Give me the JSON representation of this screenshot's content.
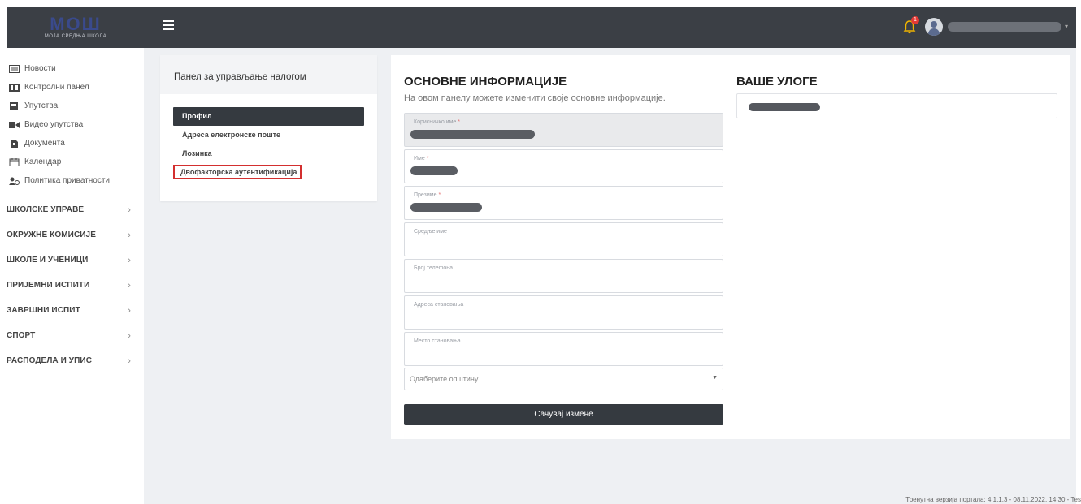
{
  "header": {
    "logo_text": "МОШ",
    "logo_subtitle": "МОЈА СРЕДЊА ШКОЛА",
    "notification_count": "1"
  },
  "sidebar": {
    "items": [
      {
        "label": "Новости",
        "icon": "newspaper-icon"
      },
      {
        "label": "Контролни панел",
        "icon": "dashboard-icon"
      },
      {
        "label": "Упутства",
        "icon": "book-icon"
      },
      {
        "label": "Видео упутства",
        "icon": "video-icon"
      },
      {
        "label": "Документа",
        "icon": "document-icon"
      },
      {
        "label": "Календар",
        "icon": "calendar-icon"
      },
      {
        "label": "Политика приватности",
        "icon": "users-privacy-icon"
      }
    ],
    "sections": [
      {
        "label": "ШКОЛСКЕ УПРАВЕ"
      },
      {
        "label": "ОКРУЖНЕ КОМИСИЈЕ"
      },
      {
        "label": "ШКОЛЕ И УЧЕНИЦИ"
      },
      {
        "label": "ПРИЈЕМНИ ИСПИТИ"
      },
      {
        "label": "ЗАВРШНИ ИСПИТ"
      },
      {
        "label": "СПОРТ"
      },
      {
        "label": "РАСПОДЕЛА И УПИС"
      }
    ],
    "chevron": "›"
  },
  "account_panel": {
    "title": "Панел за управљање налогом",
    "menu": [
      {
        "label": "Профил"
      },
      {
        "label": "Адреса електронске поште"
      },
      {
        "label": "Лозинка"
      },
      {
        "label": "Двофакторска аутентификација"
      }
    ]
  },
  "basic_info": {
    "title": "ОСНОВНЕ ИНФОРМАЦИЈЕ",
    "subtitle": "На овом панелу можете изменити своје основне информације.",
    "fields": [
      {
        "label": "Корисничко име",
        "required": "*"
      },
      {
        "label": "Име",
        "required": "*"
      },
      {
        "label": "Презиме",
        "required": "*"
      },
      {
        "label": "Средње име",
        "required": ""
      },
      {
        "label": "Број телефона",
        "required": ""
      },
      {
        "label": "Адреса становања",
        "required": ""
      },
      {
        "label": "Место становања",
        "required": ""
      }
    ],
    "municipality_placeholder": "Одаберите општину",
    "save_label": "Сачувај измене"
  },
  "roles": {
    "title": "ВАШЕ УЛОГЕ"
  },
  "footer": {
    "version_text": "Тренутна верзија портала: 4.1.1.3 - 08.11.2022. 14:30 - Tes"
  }
}
